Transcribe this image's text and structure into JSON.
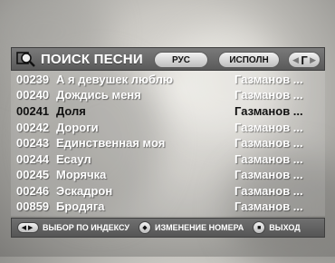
{
  "header": {
    "title": "ПОИСК ПЕСНИ",
    "language_button": "РУС",
    "mode_button": "ИСПОЛН",
    "alphabet_letter": "Г"
  },
  "songs": [
    {
      "number": "00239",
      "title": "А я девушек люблю",
      "artist": "Газманов ...",
      "selected": false
    },
    {
      "number": "00240",
      "title": "Дождись меня",
      "artist": "Газманов ...",
      "selected": false
    },
    {
      "number": "00241",
      "title": "Доля",
      "artist": "Газманов ...",
      "selected": true
    },
    {
      "number": "00242",
      "title": "Дороги",
      "artist": "Газманов ...",
      "selected": false
    },
    {
      "number": "00243",
      "title": "Единственная моя",
      "artist": "Газманов ...",
      "selected": false
    },
    {
      "number": "00244",
      "title": "Есаул",
      "artist": "Газманов ...",
      "selected": false
    },
    {
      "number": "00245",
      "title": "Морячка",
      "artist": "Газманов ...",
      "selected": false
    },
    {
      "number": "00246",
      "title": "Эскадрон",
      "artist": "Газманов ...",
      "selected": false
    },
    {
      "number": "00859",
      "title": "Бродяга",
      "artist": "Газманов ...",
      "selected": false
    }
  ],
  "footer": {
    "index_hint": "ВЫБОР ПО ИНДЕКСУ",
    "number_hint": "ИЗМЕНЕНИЕ НОМЕРА",
    "exit_hint": "ВЫХОД"
  },
  "icons": {
    "search": "magnifier-icon",
    "left_right": "left-right-arrows-icon",
    "up_down": "up-down-button-icon",
    "exit": "stop-button-icon"
  },
  "colors": {
    "bar_background": "#5f5f5f",
    "row_text": "#ffffff",
    "selected_text": "#111111"
  }
}
